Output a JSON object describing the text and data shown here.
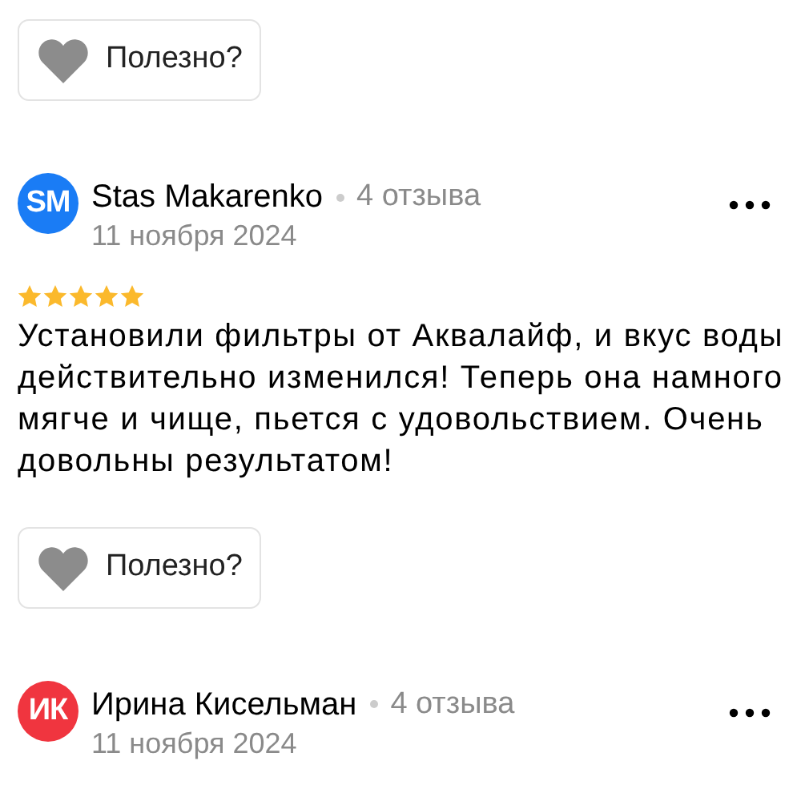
{
  "top_helpful_button": {
    "label": "Полезно?"
  },
  "reviews": [
    {
      "initials": "SM",
      "color": "#1a7cf5",
      "name": "Stas Makarenko",
      "review_count": "4 отзыва",
      "date": "11 ноября 2024",
      "stars": 5,
      "text": "Установили фильтры от Аквалайф, и вкус воды действительно изменился! Теперь она намного мягче и чище, пьется с удовольствием. Очень довольны результатом!",
      "helpful_button": {
        "label": "Полезно?"
      }
    },
    {
      "initials": "ИК",
      "color": "#f0353f",
      "name": "Ирина Кисельман",
      "review_count": "4 отзыва",
      "date": "11 ноября 2024"
    }
  ]
}
